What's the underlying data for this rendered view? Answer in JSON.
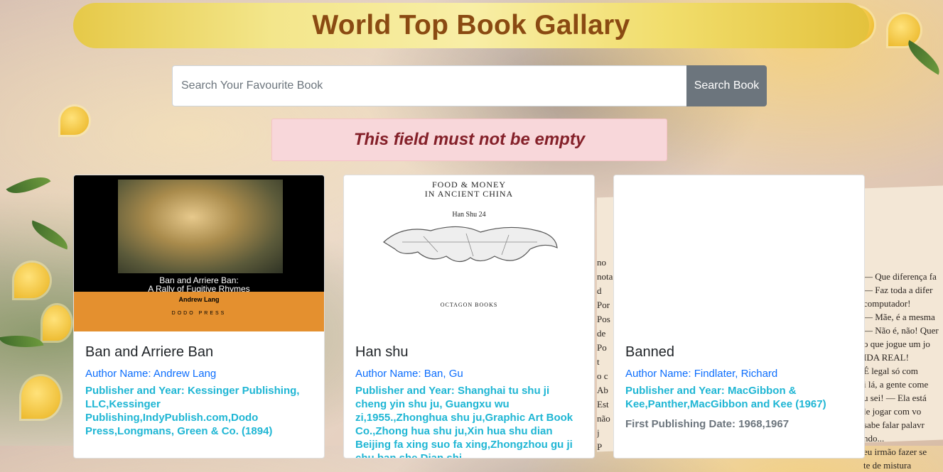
{
  "header": {
    "title": "World Top Book Gallary"
  },
  "search": {
    "placeholder": "Search Your Favourite Book",
    "value": "",
    "button_label": "Search Book"
  },
  "alert": {
    "message": "This field must not be empty"
  },
  "colors": {
    "header_text": "#8a4a12",
    "alert_bg": "#f8d7da",
    "alert_text": "#842029",
    "button_bg": "#6c757d",
    "author_text": "#0d6efd",
    "publisher_text": "#1fb6d4"
  },
  "background": {
    "book_right_lines": "— Que diferença fa\n— Faz toda a difer\ncomputador!\n— Mãe, é a mesma\n— Não é, não! Quer\no que jogue um jo\nIDA REAL!\nÉ legal só com\ni lá, a gente come\nu sei! — Ela está\nle jogar com vo\nsabe falar palavr\nndo...\neu irmão fazer se\nte de mistura",
    "book_left_lines": "no\nnota\nd\nPor\nPos\nde\nPo\nt\no c\nAb\nEst\nnão\nj\nP"
  },
  "books": [
    {
      "title": "Ban and Arriere Ban",
      "author": "Author Name: Andrew Lang",
      "publisher": "Publisher and Year: Kessinger Publishing, LLC,Kessinger Publishing,IndyPublish.com,Dodo Press,Longmans, Green & Co. (1894)",
      "first_pub": "",
      "cover": {
        "title_line1": "Ban and Arriere Ban:",
        "title_line2": "A Rally of Fugitive Rhymes",
        "author": "Andrew Lang",
        "publisher": "DODO PRESS"
      }
    },
    {
      "title": "Han shu",
      "author": "Author Name: Ban, Gu",
      "publisher": "Publisher and Year: Shanghai tu shu ji cheng yin shu ju, Guangxu wu zi,1955.,Zhonghua shu ju,Graphic Art Book Co.,Zhong hua shu ju,Xin hua shu dian Beijing fa xing suo fa xing,Zhongzhou gu ji chu ban she,Dian shi",
      "first_pub": "",
      "cover": {
        "line1": "FOOD & MONEY",
        "line2": "IN ANCIENT CHINA",
        "line3": "Han Shu 24",
        "publisher": "OCTAGON BOOKS"
      }
    },
    {
      "title": "Banned",
      "author": "Author Name: Findlater, Richard",
      "publisher": "Publisher and Year: MacGibbon & Kee,Panther,MacGibbon and Kee (1967)",
      "first_pub": "First Publishing Date: 1968,1967"
    }
  ]
}
